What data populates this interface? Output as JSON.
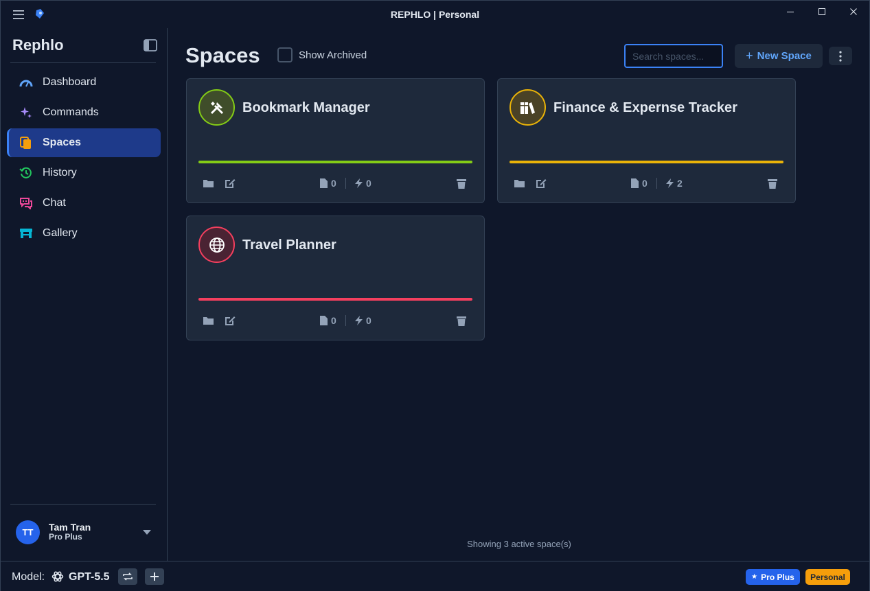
{
  "window": {
    "title": "REPHLO | Personal"
  },
  "sidebar": {
    "brand": "Rephlo",
    "items": [
      {
        "label": "Dashboard",
        "icon": "gauge-icon",
        "color": "#60a5fa"
      },
      {
        "label": "Commands",
        "icon": "sparkle-icon",
        "color": "#a78bfa"
      },
      {
        "label": "Spaces",
        "icon": "spaces-icon",
        "color": "#f59e0b",
        "active": true
      },
      {
        "label": "History",
        "icon": "history-icon",
        "color": "#22c55e"
      },
      {
        "label": "Chat",
        "icon": "chat-icon",
        "color": "#ec4899"
      },
      {
        "label": "Gallery",
        "icon": "gallery-icon",
        "color": "#06b6d4"
      }
    ],
    "user": {
      "initials": "TT",
      "name": "Tam Tran",
      "plan": "Pro Plus"
    }
  },
  "main": {
    "title": "Spaces",
    "show_archived_label": "Show Archived",
    "search_placeholder": "Search spaces...",
    "new_space_label": "New Space",
    "spaces": [
      {
        "name": "Bookmark Manager",
        "icon": "tools-icon",
        "color": "#84cc16",
        "files": "0",
        "commands": "0"
      },
      {
        "name": "Finance & Expernse Tracker",
        "icon": "books-icon",
        "color": "#eab308",
        "files": "0",
        "commands": "2"
      },
      {
        "name": "Travel Planner",
        "icon": "globe-icon",
        "color": "#f43f5e",
        "files": "0",
        "commands": "0"
      }
    ],
    "footer_text": "Showing 3 active space(s)"
  },
  "statusbar": {
    "model_label": "Model:",
    "model_name": "GPT-5.5",
    "plan_badge": "Pro Plus",
    "workspace_badge": "Personal"
  }
}
